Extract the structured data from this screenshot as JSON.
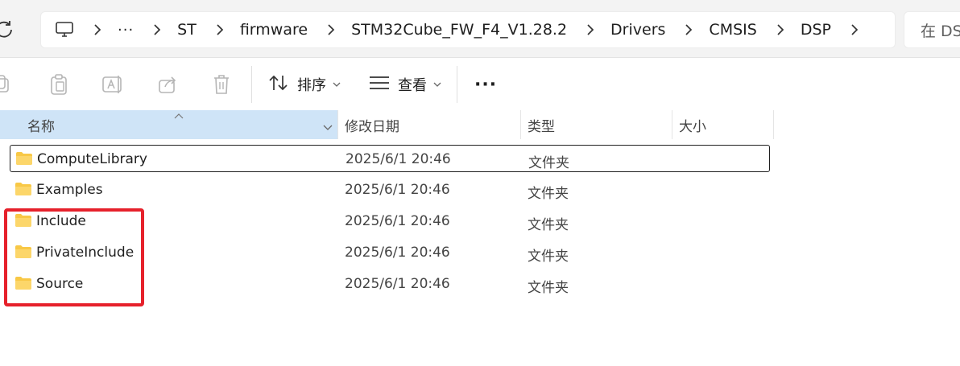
{
  "breadcrumb": {
    "overflow": "···",
    "items": [
      "ST",
      "firmware",
      "STM32Cube_FW_F4_V1.28.2",
      "Drivers",
      "CMSIS",
      "DSP"
    ]
  },
  "search": {
    "placeholder": "在 DSP"
  },
  "toolbar": {
    "sort_label": "排序",
    "view_label": "查看",
    "more_label": "···"
  },
  "columns": {
    "name": "名称",
    "date": "修改日期",
    "type": "类型",
    "size": "大小"
  },
  "files": [
    {
      "name": "ComputeLibrary",
      "date": "2025/6/1 20:46",
      "type": "文件夹"
    },
    {
      "name": "Examples",
      "date": "2025/6/1 20:46",
      "type": "文件夹"
    },
    {
      "name": "Include",
      "date": "2025/6/1 20:46",
      "type": "文件夹"
    },
    {
      "name": "PrivateInclude",
      "date": "2025/6/1 20:46",
      "type": "文件夹"
    },
    {
      "name": "Source",
      "date": "2025/6/1 20:46",
      "type": "文件夹"
    }
  ],
  "colors": {
    "folder": "#f8c846",
    "highlight": "#e6212b",
    "header_selected": "#cfe4f7"
  }
}
